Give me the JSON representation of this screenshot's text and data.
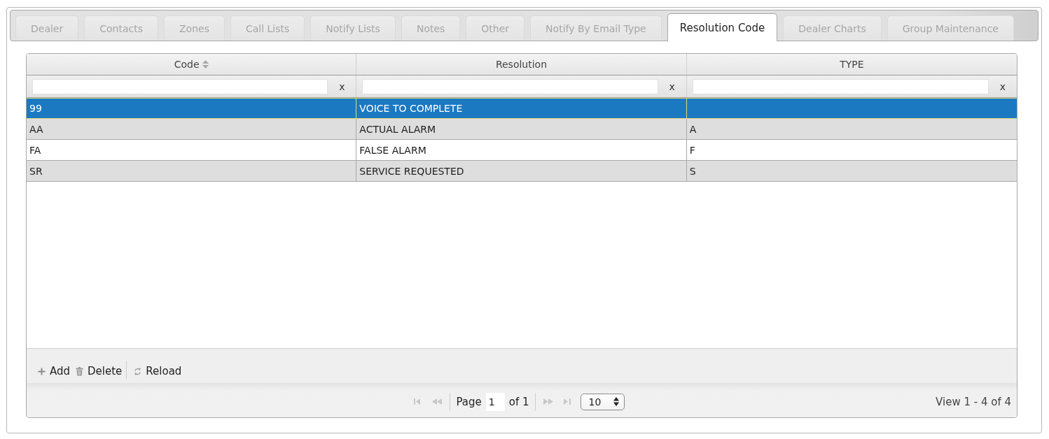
{
  "tabs": [
    {
      "label": "Dealer",
      "selected": false
    },
    {
      "label": "Contacts",
      "selected": false
    },
    {
      "label": "Zones",
      "selected": false
    },
    {
      "label": "Call Lists",
      "selected": false
    },
    {
      "label": "Notify Lists",
      "selected": false
    },
    {
      "label": "Notes",
      "selected": false
    },
    {
      "label": "Other",
      "selected": false
    },
    {
      "label": "Notify By Email Type",
      "selected": false
    },
    {
      "label": "Resolution Code",
      "selected": true
    },
    {
      "label": "Dealer Charts",
      "selected": false
    },
    {
      "label": "Group Maintenance",
      "selected": false
    }
  ],
  "grid": {
    "columns": [
      {
        "label": "Code",
        "sortable": true
      },
      {
        "label": "Resolution",
        "sortable": false
      },
      {
        "label": "TYPE",
        "sortable": false
      }
    ],
    "filters": [
      {
        "clear": "x"
      },
      {
        "clear": "x"
      },
      {
        "clear": "x"
      }
    ],
    "rows": [
      {
        "cells": [
          "99",
          "VOICE TO COMPLETE"
        ],
        "selected": true
      },
      {
        "cells": [
          "AA",
          "ACTUAL ALARM",
          "A"
        ],
        "selected": false
      },
      {
        "cells": [
          "FA",
          "FALSE ALARM",
          "F"
        ],
        "selected": false
      },
      {
        "cells": [
          "SR",
          "SERVICE REQUESTED",
          "S"
        ],
        "selected": false
      }
    ]
  },
  "toolbar": [
    {
      "kind": "add",
      "label": "Add"
    },
    {
      "kind": "delete",
      "label": "Delete"
    },
    {
      "kind": "reload",
      "label": "Reload"
    }
  ],
  "pager": {
    "nav": [
      {
        "kind": "first",
        "disabled": true
      },
      {
        "kind": "prev",
        "disabled": true
      },
      {
        "kind": "next",
        "disabled": true
      },
      {
        "kind": "last",
        "disabled": true
      }
    ],
    "page_label": "Page",
    "page": "1",
    "page_count": "of 1",
    "page_size": "10",
    "summary": "View 1 - 4 of 4"
  }
}
